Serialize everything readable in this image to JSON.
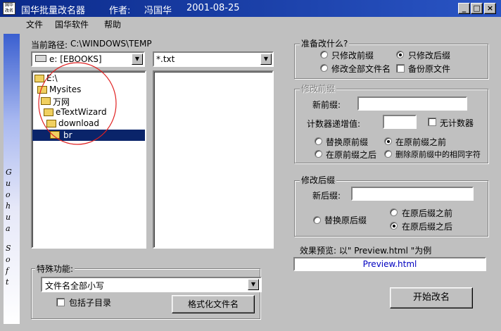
{
  "title_bar": {
    "icon_text": "国华改名",
    "app_name": "国华批量改名器",
    "author_label": "作者:",
    "author_name": "冯国华",
    "date": "2001-08-25",
    "minimize": "_",
    "maximize": "□",
    "close": "×"
  },
  "menu": [
    "文件",
    "国华软件",
    "帮助"
  ],
  "sidebar_letters": [
    "G",
    "u",
    "o",
    "h",
    "u",
    "a",
    "S",
    "o",
    "f",
    "t"
  ],
  "current_path": {
    "label": "当前路径:",
    "value": "C:\\WINDOWS\\TEMP"
  },
  "drive_select": {
    "value": "e: [EBOOKS]"
  },
  "filter_select": {
    "value": "*.txt"
  },
  "folder_tree": [
    {
      "name": "E:\\"
    },
    {
      "name": "Mysites"
    },
    {
      "name": "万网"
    },
    {
      "name": "eTextWizard"
    },
    {
      "name": "download"
    },
    {
      "name": "br",
      "selected": true
    }
  ],
  "prepare_group": {
    "title": "准备改什么?",
    "options": [
      {
        "label": "只修改前缀",
        "selected": false
      },
      {
        "label": "只修改后缀",
        "selected": true
      },
      {
        "label": "修改全部文件名",
        "selected": false
      }
    ],
    "backup_label": "备份原文件",
    "backup_checked": false
  },
  "prefix_group": {
    "title": "修改前缀",
    "new_prefix_label": "新前缀:",
    "new_prefix_value": "",
    "counter_label": "计数器递增值:",
    "counter_value": "",
    "no_counter_label": "无计数器",
    "no_counter_checked": false,
    "options": [
      {
        "label": "替换原前缀",
        "selected": false
      },
      {
        "label": "在原前缀之前",
        "selected": true
      },
      {
        "label": "在原前缀之后",
        "selected": false
      },
      {
        "label": "删除原前缀中的相同字符",
        "selected": false
      }
    ]
  },
  "suffix_group": {
    "title": "修改后缀",
    "new_suffix_label": "新后缀:",
    "new_suffix_value": "",
    "options": [
      {
        "label": "替换原后缀",
        "selected": false
      },
      {
        "label": "在原后缀之前",
        "selected": false
      },
      {
        "label": "在原后缀之后",
        "selected": true
      }
    ]
  },
  "preview": {
    "label": "效果预览: 以\" Preview.html \"为例",
    "value": "Preview.html"
  },
  "special_group": {
    "title": "特殊功能:",
    "function_value": "文件名全部小写",
    "include_subdirs_label": "包括子目录",
    "include_subdirs_checked": false,
    "format_button": "格式化文件名"
  },
  "start_button": "开始改名",
  "colors": {
    "title_bar": "#0b2a8a",
    "selection": "#0a246a",
    "annotation_circle": "#e02020"
  }
}
